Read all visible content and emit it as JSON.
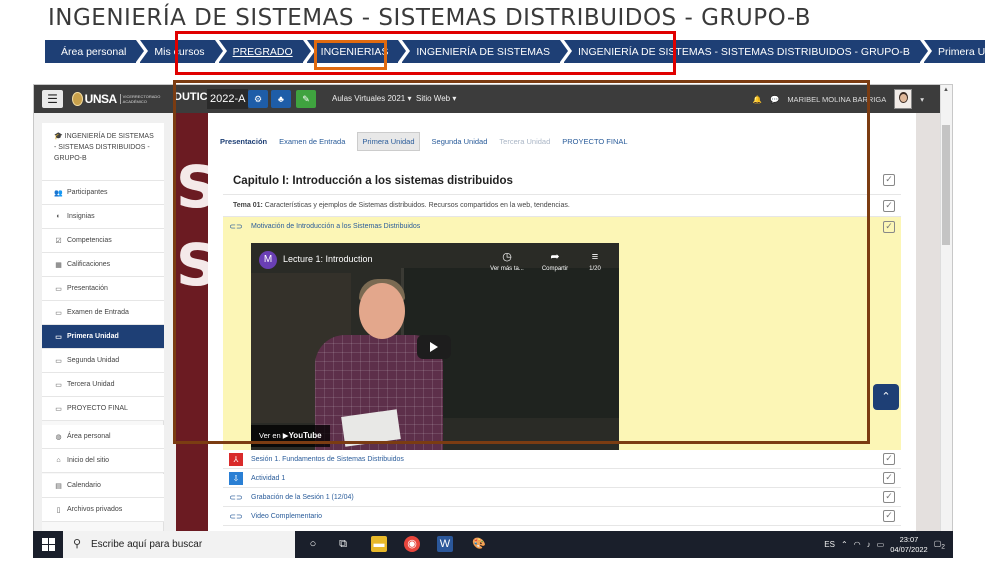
{
  "slide_title": "INGENIERÍA DE SISTEMAS - SISTEMAS DISTRIBUIDOS - GRUPO-B",
  "breadcrumbs": [
    {
      "label": "Área personal"
    },
    {
      "label": "Mis cursos"
    },
    {
      "label": "PREGRADO"
    },
    {
      "label": "INGENIERIAS"
    },
    {
      "label": "INGENIERÍA DE SISTEMAS"
    },
    {
      "label": "INGENIERÍA DE SISTEMAS - SISTEMAS DISTRIBUIDOS - GRUPO-B"
    },
    {
      "label": "Primera Unidad"
    }
  ],
  "navbar": {
    "menu_icon": "☰",
    "logo_text": "UNSA",
    "logo_sub": "VICERRECTORADO ACADÉMICO",
    "dutic": "DUTIC",
    "year": "2022-A",
    "aulas": "Aulas Virtuales 2021 ▾",
    "sitio": "Sitio Web ▾",
    "user": "MARIBEL MOLINA BARRIGA"
  },
  "sidebar": {
    "course": "INGENIERÍA DE SISTEMAS - SISTEMAS DISTRIBUIDOS - GRUPO-B",
    "items": [
      {
        "label": "Participantes",
        "icon": "participants-icon"
      },
      {
        "label": "Insignias",
        "icon": "badge-icon"
      },
      {
        "label": "Competencias",
        "icon": "competencies-icon"
      },
      {
        "label": "Calificaciones",
        "icon": "grades-icon"
      },
      {
        "label": "Presentación",
        "icon": "folder-icon"
      },
      {
        "label": "Examen de Entrada",
        "icon": "folder-icon"
      },
      {
        "label": "Primera Unidad",
        "icon": "folder-icon",
        "active": true
      },
      {
        "label": "Segunda Unidad",
        "icon": "folder-icon"
      },
      {
        "label": "Tercera Unidad",
        "icon": "folder-icon"
      },
      {
        "label": "PROYECTO FINAL",
        "icon": "folder-icon"
      },
      {
        "label": "Área personal",
        "icon": "dashboard-icon"
      },
      {
        "label": "Inicio del sitio",
        "icon": "home-icon"
      },
      {
        "label": "Calendario",
        "icon": "calendar-icon"
      },
      {
        "label": "Archivos privados",
        "icon": "file-icon"
      }
    ]
  },
  "tabs": [
    {
      "label": "Presentación",
      "state": "active"
    },
    {
      "label": "Examen de Entrada",
      "state": "normal"
    },
    {
      "label": "Primera Unidad",
      "state": "current"
    },
    {
      "label": "Segunda Unidad",
      "state": "normal"
    },
    {
      "label": "Tercera Unidad",
      "state": "disabled"
    },
    {
      "label": "PROYECTO FINAL",
      "state": "normal"
    }
  ],
  "section": {
    "title": "Capitulo I: Introducción a los sistemas distribuidos",
    "topic_label": "Tema 01:",
    "topic_text": " Características y ejemplos de Sistemas distribuidos. Recursos compartidos en la web, tendencias.",
    "highlight_activity": "Motivación de Introducción a los Sistemas Distribuidos",
    "activities": [
      {
        "label": "Sesión 1. Fundamentos de Sistemas Distribuidos",
        "icon": "pdf-icon"
      },
      {
        "label": "Actividad 1",
        "icon": "assignment-icon"
      },
      {
        "label": "Grabación de la Sesión 1 (12/04)",
        "icon": "link-icon"
      },
      {
        "label": "Video Complementario",
        "icon": "link-icon"
      }
    ]
  },
  "video": {
    "channel_letter": "M",
    "title": "Lecture 1: Introduction",
    "watch_later": "Ver más ta...",
    "share": "Compartir",
    "playlist": "1/20",
    "watch_on": "Ver en",
    "youtube": "YouTube"
  },
  "taskbar": {
    "search_placeholder": "Escribe aquí para buscar",
    "lang": "ES",
    "time": "23:07",
    "date": "04/07/2022",
    "notifications": "2"
  },
  "colors": {
    "accent": "#1e3f75",
    "red_box": "#e00000",
    "orange_box": "#e06a10",
    "brown_box": "#7b3c12",
    "highlight": "#fcf6b6"
  }
}
